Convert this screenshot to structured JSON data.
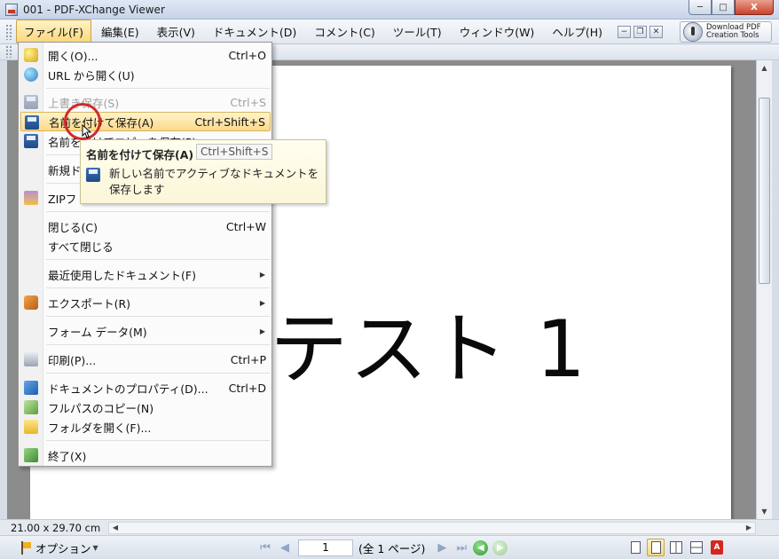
{
  "window": {
    "title": "001 - PDF-XChange Viewer",
    "minimize": "─",
    "maximize": "□",
    "close": "X"
  },
  "menubar": {
    "items": [
      {
        "name": "menu-file",
        "label": "ファイル(F)"
      },
      {
        "name": "menu-edit",
        "label": "編集(E)"
      },
      {
        "name": "menu-view",
        "label": "表示(V)"
      },
      {
        "name": "menu-document",
        "label": "ドキュメント(D)"
      },
      {
        "name": "menu-comment",
        "label": "コメント(C)"
      },
      {
        "name": "menu-tools",
        "label": "ツール(T)"
      },
      {
        "name": "menu-window",
        "label": "ウィンドウ(W)"
      },
      {
        "name": "menu-help",
        "label": "ヘルプ(H)"
      }
    ],
    "download": {
      "line1": "Download PDF",
      "line2": "Creation Tools"
    }
  },
  "file_menu": {
    "items": [
      {
        "label": "開く(O)...",
        "shortcut": "Ctrl+O",
        "icon": "open-icon"
      },
      {
        "label": "URL から開く(U)",
        "shortcut": "",
        "icon": "url-icon"
      },
      {
        "label": "上書き保存(S)",
        "shortcut": "Ctrl+S",
        "icon": "save-icon",
        "disabled": true
      },
      {
        "label": "名前を付けて保存(A)",
        "shortcut": "Ctrl+Shift+S",
        "icon": "save-as-icon",
        "highlighted": true
      },
      {
        "label": "名前を付けてコピーを保存(P)",
        "shortcut": "",
        "icon": "save-copy-icon"
      },
      {
        "label": "新規ド",
        "shortcut": "",
        "icon": ""
      },
      {
        "label": "ZIPフ",
        "shortcut": "",
        "icon": "zip-icon"
      },
      {
        "label": "閉じる(C)",
        "shortcut": "Ctrl+W",
        "icon": ""
      },
      {
        "label": "すべて閉じる",
        "shortcut": "",
        "icon": ""
      },
      {
        "label": "最近使用したドキュメント(F)",
        "shortcut": "",
        "icon": "",
        "submenu": true
      },
      {
        "label": "エクスポート(R)",
        "shortcut": "",
        "icon": "export-icon",
        "submenu": true
      },
      {
        "label": "フォーム データ(M)",
        "shortcut": "",
        "icon": "",
        "submenu": true
      },
      {
        "label": "印刷(P)...",
        "shortcut": "Ctrl+P",
        "icon": "print-icon"
      },
      {
        "label": "ドキュメントのプロパティ(D)...",
        "shortcut": "Ctrl+D",
        "icon": "properties-icon"
      },
      {
        "label": "フルパスのコピー(N)",
        "shortcut": "",
        "icon": "copy-path-icon"
      },
      {
        "label": "フォルダを開く(F)...",
        "shortcut": "",
        "icon": "folder-icon"
      },
      {
        "label": "終了(X)",
        "shortcut": "",
        "icon": "exit-icon"
      }
    ]
  },
  "tooltip": {
    "title": "名前を付けて保存(A)",
    "shortcut": "Ctrl+Shift+S",
    "description": "新しい名前でアクティブなドキュメントを保存します"
  },
  "document": {
    "text": "テスト 1"
  },
  "statusbar": {
    "page_size": "21.00 x 29.70 cm"
  },
  "bottombar": {
    "options_label": "オプション",
    "page_number": "1",
    "page_total": "(全 1 ページ)"
  }
}
